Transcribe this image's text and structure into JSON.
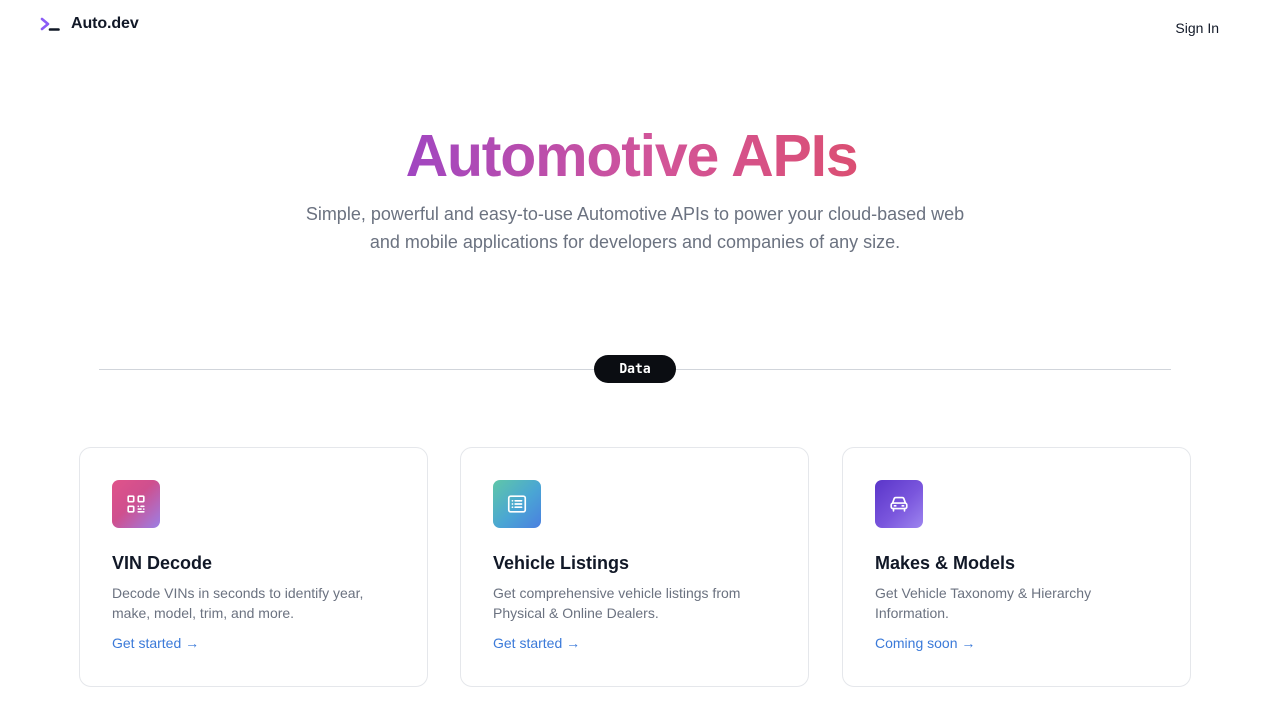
{
  "header": {
    "brand": "Auto.dev",
    "logo_icon": "terminal-prompt-icon",
    "brand_colors": {
      "chevron": "#8b5cf6",
      "underscore": "#111827"
    },
    "sign_in": "Sign In"
  },
  "hero": {
    "title": "Automotive APIs",
    "title_gradient": [
      "#a046c1",
      "#d25499",
      "#db4f73"
    ],
    "subtitle": "Simple, powerful and easy-to-use Automotive APIs to power your cloud-based web and mobile applications for developers and companies of any size."
  },
  "section": {
    "label": "Data"
  },
  "cards": [
    {
      "icon": "qr-code-icon",
      "title": "VIN Decode",
      "description": "Decode VINs in seconds to identify year, make, model, trim, and more.",
      "link": "Get started →"
    },
    {
      "icon": "list-icon",
      "title": "Vehicle Listings",
      "description": "Get comprehensive vehicle listings from Physical & Online Dealers.",
      "link": "Get started →"
    },
    {
      "icon": "car-icon",
      "title": "Makes & Models",
      "description": "Get Vehicle Taxonomy & Hierarchy Information.",
      "link": "Coming soon →"
    }
  ],
  "colors": {
    "link": "#3b7ad9",
    "muted_text": "#6b7280",
    "pill_bg": "#0b0d12"
  }
}
